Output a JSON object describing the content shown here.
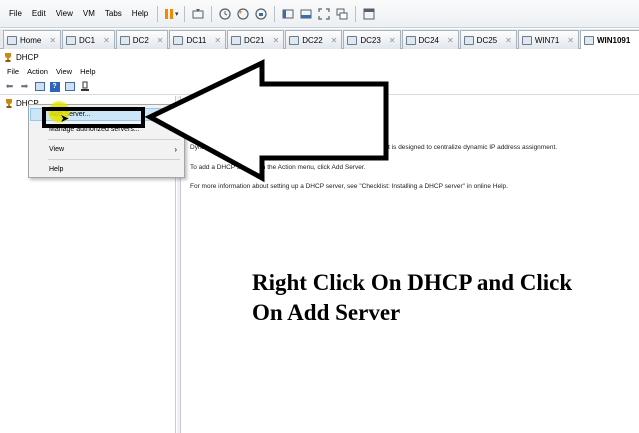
{
  "vm_menu": [
    "File",
    "Edit",
    "View",
    "VM",
    "Tabs",
    "Help"
  ],
  "tabs": [
    {
      "label": "Home",
      "active": false
    },
    {
      "label": "DC1",
      "active": false
    },
    {
      "label": "DC2",
      "active": false
    },
    {
      "label": "DC11",
      "active": false
    },
    {
      "label": "DC21",
      "active": false
    },
    {
      "label": "DC22",
      "active": false
    },
    {
      "label": "DC23",
      "active": false
    },
    {
      "label": "DC24",
      "active": false
    },
    {
      "label": "DC25",
      "active": false
    },
    {
      "label": "WIN71",
      "active": false
    },
    {
      "label": "WIN1091",
      "active": true
    }
  ],
  "window": {
    "title": "DHCP",
    "menu": [
      "File",
      "Action",
      "View",
      "Help"
    ]
  },
  "tree": {
    "root_label": "DHCP"
  },
  "context_menu": {
    "items": [
      {
        "label": "Add Server...",
        "highlighted": true
      },
      {
        "label": "Manage authorized servers..."
      },
      {
        "label": "View",
        "submenu": true
      },
      {
        "label": "Help"
      }
    ]
  },
  "content": {
    "p1": "Dynamic Host Configuration Protocol (DHCP) is a TCP/IP standard. It is designed to centralize dynamic IP address assignment.",
    "p2": "To add a DHCP server, on the Action menu, click Add Server.",
    "p3": "For more information about setting up a DHCP server, see \"Checklist: Installing a DHCP server\" in online Help."
  },
  "annotation": {
    "caption": "Right Click On DHCP and Click On Add Server"
  },
  "colors": {
    "accent_orange": "#f08a00",
    "menu_highlight": "#cde6f7",
    "logo_blue": "#2d63b8"
  }
}
